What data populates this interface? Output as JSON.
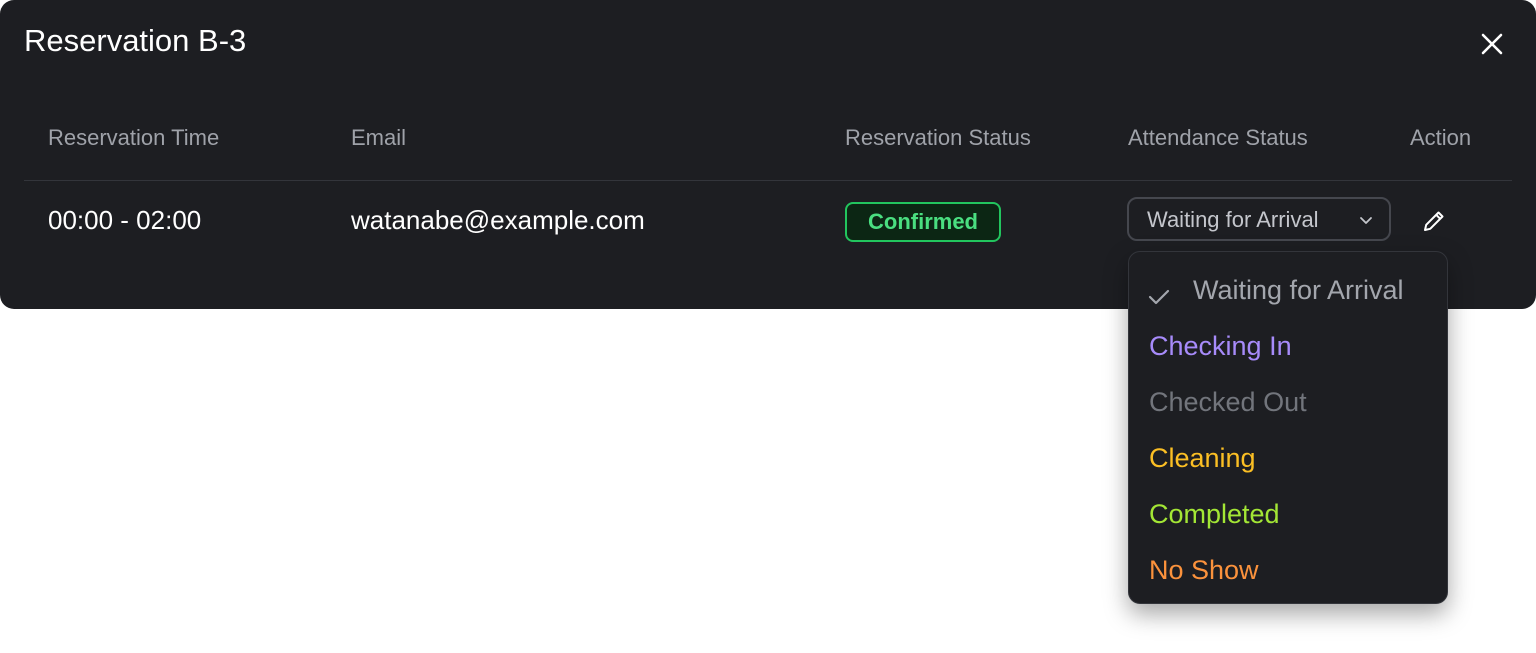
{
  "modal": {
    "title": "Reservation B-3"
  },
  "table": {
    "headers": {
      "time": "Reservation Time",
      "email": "Email",
      "reservation_status": "Reservation Status",
      "attendance_status": "Attendance Status",
      "action": "Action"
    },
    "row": {
      "time": "00:00 - 02:00",
      "email": "watanabe@example.com",
      "reservation_status": "Confirmed",
      "attendance_status": "Waiting for Arrival"
    }
  },
  "dropdown": {
    "options": [
      {
        "label": "Waiting for Arrival",
        "selected": true,
        "color": "#a3a6ad"
      },
      {
        "label": "Checking In",
        "selected": false,
        "color": "#a78bfa"
      },
      {
        "label": "Checked Out",
        "selected": false,
        "color": "#72757c"
      },
      {
        "label": "Cleaning",
        "selected": false,
        "color": "#fbbf24"
      },
      {
        "label": "Completed",
        "selected": false,
        "color": "#a3e635"
      },
      {
        "label": "No Show",
        "selected": false,
        "color": "#fb923c"
      }
    ]
  },
  "icons": {
    "close": "close-icon",
    "chevron": "chevron-down-icon",
    "edit": "pencil-icon",
    "check": "check-icon"
  },
  "colors": {
    "modal_bg": "#1d1e22",
    "confirmed_badge": "#22c55e"
  }
}
